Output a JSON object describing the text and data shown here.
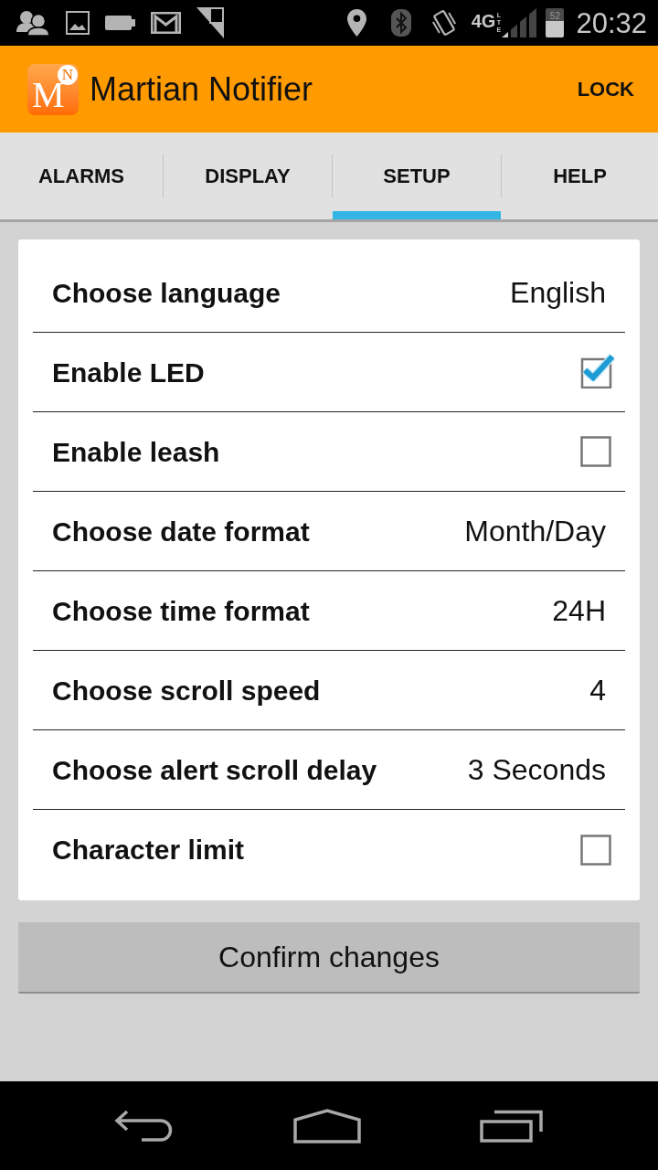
{
  "status_bar": {
    "network": "4G",
    "network_sub": "LTE",
    "battery": "52",
    "time": "20:32"
  },
  "app_bar": {
    "logo_letter": "M",
    "logo_badge": "N",
    "title": "Martian Notifier",
    "action": "LOCK"
  },
  "tabs": [
    {
      "label": "ALARMS",
      "selected": false
    },
    {
      "label": "DISPLAY",
      "selected": false
    },
    {
      "label": "SETUP",
      "selected": true
    },
    {
      "label": "HELP",
      "selected": false
    }
  ],
  "settings": [
    {
      "kind": "value",
      "label": "Choose language",
      "value": "English"
    },
    {
      "kind": "checkbox",
      "label": "Enable LED",
      "checked": true
    },
    {
      "kind": "checkbox",
      "label": "Enable leash",
      "checked": false
    },
    {
      "kind": "value",
      "label": "Choose date format",
      "value": "Month/Day"
    },
    {
      "kind": "value",
      "label": "Choose time format",
      "value": "24H"
    },
    {
      "kind": "value",
      "label": "Choose scroll speed",
      "value": "4"
    },
    {
      "kind": "value",
      "label": "Choose alert scroll delay",
      "value": "3 Seconds"
    },
    {
      "kind": "checkbox",
      "label": "Character limit",
      "checked": false
    }
  ],
  "confirm_button": "Confirm changes"
}
